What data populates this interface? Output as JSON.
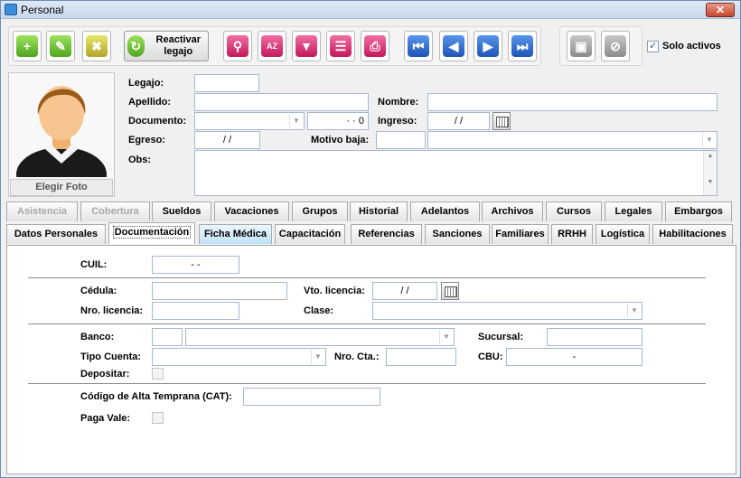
{
  "window": {
    "title": "Personal",
    "close": "✕"
  },
  "toolbar": {
    "buttons": [
      {
        "name": "add-icon",
        "color": "g",
        "glyph": "+"
      },
      {
        "name": "edit-icon",
        "color": "g",
        "glyph": "✎"
      },
      {
        "name": "delete-icon",
        "color": "y",
        "glyph": "✖"
      },
      {
        "name": "search-icon",
        "color": "p",
        "glyph": "⚲"
      },
      {
        "name": "sort-az-icon",
        "color": "p",
        "glyph": "AZ"
      },
      {
        "name": "filter-icon",
        "color": "p",
        "glyph": "▼"
      },
      {
        "name": "report-icon",
        "color": "p",
        "glyph": "☰"
      },
      {
        "name": "print-icon",
        "color": "p",
        "glyph": "⎙"
      },
      {
        "name": "first-record-icon",
        "color": "b",
        "glyph": "⏮"
      },
      {
        "name": "previous-record-icon",
        "color": "b",
        "glyph": "◀"
      },
      {
        "name": "next-record-icon",
        "color": "b",
        "glyph": "▶"
      },
      {
        "name": "last-record-icon",
        "color": "b",
        "glyph": "⏭"
      },
      {
        "name": "save-icon",
        "color": "gr",
        "glyph": "▣"
      },
      {
        "name": "cancel-icon",
        "color": "gr",
        "glyph": "⊘"
      }
    ],
    "reactivar": "Reactivar legajo",
    "solo_activos": "Solo activos",
    "solo_activos_checked": true
  },
  "photo": {
    "button": "Elegir Foto"
  },
  "form": {
    "legajo": {
      "label": "Legajo:",
      "value": ""
    },
    "apellido": {
      "label": "Apellido:",
      "value": ""
    },
    "nombre": {
      "label": "Nombre:",
      "value": ""
    },
    "documento": {
      "label": "Documento:",
      "value": "",
      "number": "·  ·  0"
    },
    "ingreso": {
      "label": "Ingreso:",
      "value": "/ /"
    },
    "egreso": {
      "label": "Egreso:",
      "value": "/ /"
    },
    "motivo_baja": {
      "label": "Motivo baja:",
      "value": ""
    },
    "obs": {
      "label": "Obs:",
      "value": ""
    }
  },
  "tabs_row1": [
    {
      "label": "Asistencia",
      "state": "dis"
    },
    {
      "label": "Cobertura",
      "state": "dis"
    },
    {
      "label": "Sueldos",
      "state": ""
    },
    {
      "label": "Vacaciones",
      "state": ""
    },
    {
      "label": "Grupos",
      "state": ""
    },
    {
      "label": "Historial",
      "state": ""
    },
    {
      "label": "Adelantos",
      "state": ""
    },
    {
      "label": "Archivos",
      "state": ""
    },
    {
      "label": "Cursos",
      "state": ""
    },
    {
      "label": "Legales",
      "state": ""
    },
    {
      "label": "Embargos",
      "state": ""
    }
  ],
  "tabs_row2": [
    {
      "label": "Datos Personales",
      "state": ""
    },
    {
      "label": "Documentación",
      "state": "act"
    },
    {
      "label": "Ficha Médica",
      "state": "hl"
    },
    {
      "label": "Capacitación",
      "state": ""
    },
    {
      "label": "Referencias",
      "state": ""
    },
    {
      "label": "Sanciones",
      "state": ""
    },
    {
      "label": "Familiares",
      "state": ""
    },
    {
      "label": "RRHH",
      "state": ""
    },
    {
      "label": "Logística",
      "state": ""
    },
    {
      "label": "Habilitaciones",
      "state": ""
    }
  ],
  "doc": {
    "cuil": {
      "label": "CUIL:",
      "value": "-        -"
    },
    "cedula": {
      "label": "Cédula:",
      "value": ""
    },
    "vto_licencia": {
      "label": "Vto. licencia:",
      "value": "/ /"
    },
    "nro_licencia": {
      "label": "Nro. licencia:",
      "value": ""
    },
    "clase": {
      "label": "Clase:",
      "value": ""
    },
    "banco": {
      "label": "Banco:",
      "code": "",
      "value": ""
    },
    "sucursal": {
      "label": "Sucursal:",
      "value": ""
    },
    "tipo_cuenta": {
      "label": "Tipo Cuenta:",
      "value": ""
    },
    "nro_cta": {
      "label": "Nro. Cta.:",
      "value": ""
    },
    "cbu": {
      "label": "CBU:",
      "value": "-"
    },
    "depositar": {
      "label": "Depositar:",
      "checked": false
    },
    "cat": {
      "label": "Código de Alta Temprana (CAT):",
      "value": ""
    },
    "paga_vale": {
      "label": "Paga Vale:",
      "checked": false
    }
  }
}
